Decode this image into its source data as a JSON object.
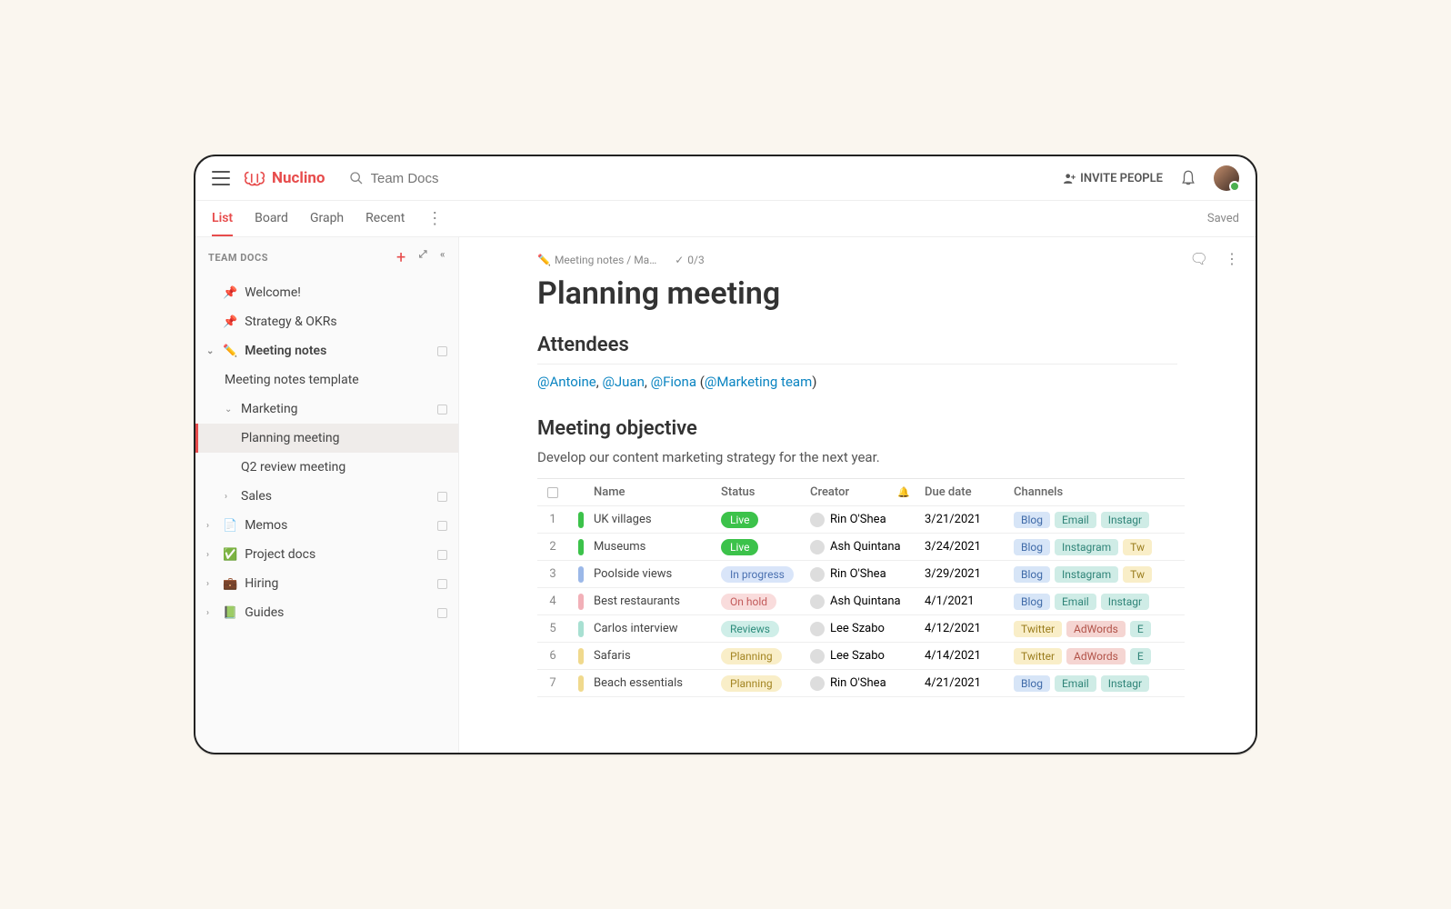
{
  "brand": "Nuclino",
  "search": {
    "placeholder": "Team Docs"
  },
  "invite_label": "INVITE PEOPLE",
  "saved_label": "Saved",
  "tabs": [
    "List",
    "Board",
    "Graph",
    "Recent"
  ],
  "sidebar": {
    "title": "TEAM DOCS",
    "pins": [
      {
        "icon": "📌",
        "label": "Welcome!"
      },
      {
        "icon": "📌",
        "label": "Strategy & OKRs"
      }
    ],
    "meeting": {
      "icon": "✏️",
      "label": "Meeting notes",
      "template": "Meeting notes template",
      "marketing": {
        "label": "Marketing",
        "items": [
          "Planning meeting",
          "Q2 review meeting"
        ]
      },
      "sales": "Sales"
    },
    "others": [
      {
        "icon": "📄",
        "label": "Memos"
      },
      {
        "icon": "✅",
        "label": "Project docs"
      },
      {
        "icon": "💼",
        "label": "Hiring"
      },
      {
        "icon": "📗",
        "label": "Guides"
      }
    ]
  },
  "doc": {
    "crumb": "Meeting notes / Ma…",
    "checks": "0/3",
    "title": "Planning meeting",
    "attendees_head": "Attendees",
    "attendees": [
      "@Antoine",
      "@Juan",
      "@Fiona"
    ],
    "attendees_group": "@Marketing team",
    "objective_head": "Meeting objective",
    "objective_text": "Develop our content marketing strategy for the next year.",
    "table": {
      "cols": [
        "Name",
        "Status",
        "Creator",
        "Due date",
        "Channels"
      ],
      "rows": [
        {
          "n": 1,
          "color": "#3cc24a",
          "name": "UK villages",
          "status": "Live",
          "status_class": "live",
          "creator": "Rin O'Shea",
          "due": "3/21/2021",
          "channels": [
            [
              "Blog",
              "blog"
            ],
            [
              "Email",
              "email"
            ],
            [
              "Instagr",
              "ig"
            ]
          ]
        },
        {
          "n": 2,
          "color": "#3cc24a",
          "name": "Museums",
          "status": "Live",
          "status_class": "live",
          "creator": "Ash Quintana",
          "due": "3/24/2021",
          "channels": [
            [
              "Blog",
              "blog"
            ],
            [
              "Instagram",
              "ig"
            ],
            [
              "Tw",
              "tw"
            ]
          ]
        },
        {
          "n": 3,
          "color": "#9bb8e8",
          "name": "Poolside views",
          "status": "In progress",
          "status_class": "progress",
          "creator": "Rin O'Shea",
          "due": "3/29/2021",
          "channels": [
            [
              "Blog",
              "blog"
            ],
            [
              "Instagram",
              "ig"
            ],
            [
              "Tw",
              "tw"
            ]
          ]
        },
        {
          "n": 4,
          "color": "#f2b0b8",
          "name": "Best restaurants",
          "status": "On hold",
          "status_class": "hold",
          "creator": "Ash Quintana",
          "due": "4/1/2021",
          "channels": [
            [
              "Blog",
              "blog"
            ],
            [
              "Email",
              "email"
            ],
            [
              "Instagr",
              "ig"
            ]
          ]
        },
        {
          "n": 5,
          "color": "#a8e0d2",
          "name": "Carlos interview",
          "status": "Reviews",
          "status_class": "reviews",
          "creator": "Lee Szabo",
          "due": "4/12/2021",
          "channels": [
            [
              "Twitter",
              "tw"
            ],
            [
              "AdWords",
              "aw"
            ],
            [
              "E",
              "email"
            ]
          ]
        },
        {
          "n": 6,
          "color": "#f0d98d",
          "name": "Safaris",
          "status": "Planning",
          "status_class": "planning",
          "creator": "Lee Szabo",
          "due": "4/14/2021",
          "channels": [
            [
              "Twitter",
              "tw"
            ],
            [
              "AdWords",
              "aw"
            ],
            [
              "E",
              "email"
            ]
          ]
        },
        {
          "n": 7,
          "color": "#f0d98d",
          "name": "Beach essentials",
          "status": "Planning",
          "status_class": "planning",
          "creator": "Rin O'Shea",
          "due": "4/21/2021",
          "channels": [
            [
              "Blog",
              "blog"
            ],
            [
              "Email",
              "email"
            ],
            [
              "Instagr",
              "ig"
            ]
          ]
        }
      ]
    }
  }
}
